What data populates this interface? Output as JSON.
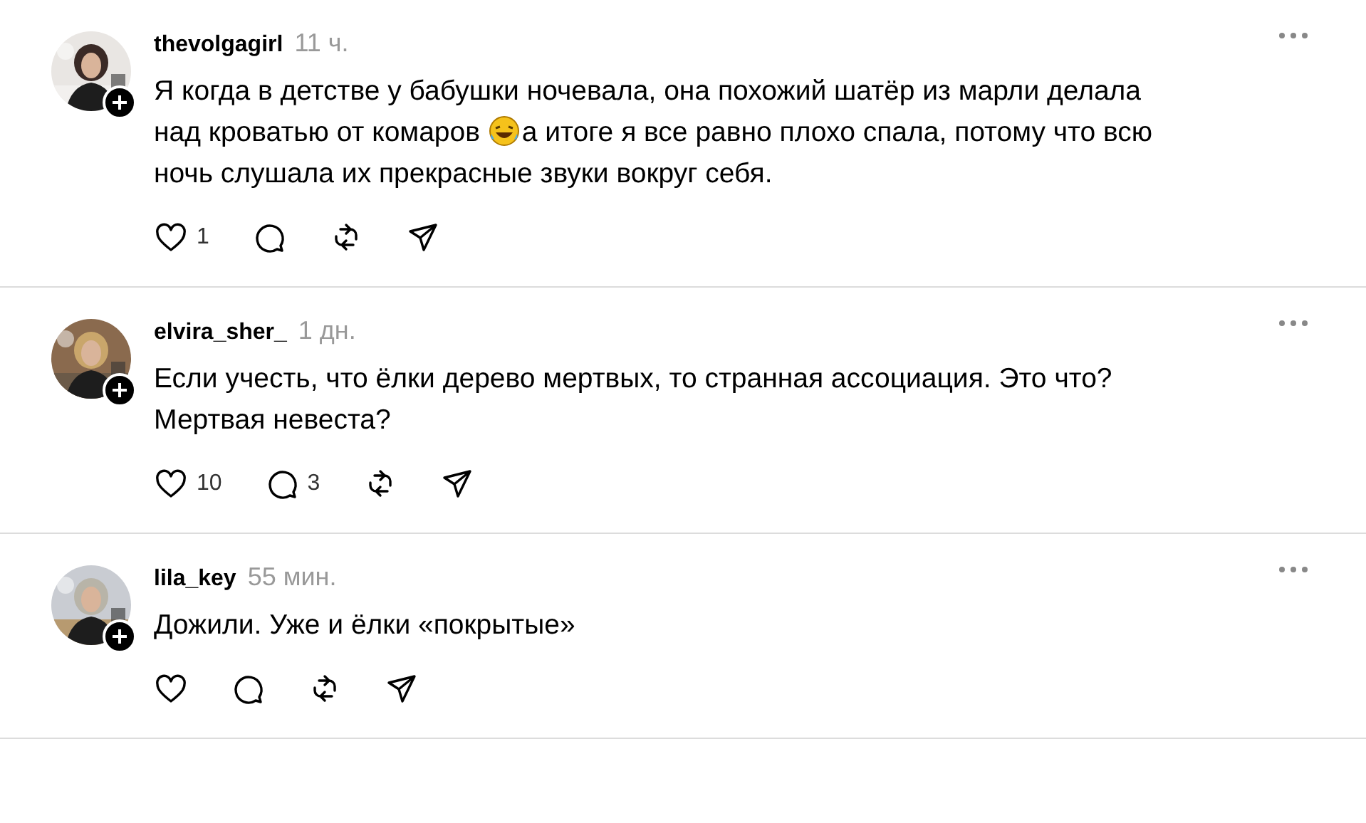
{
  "comments": [
    {
      "username": "thevolgagirl",
      "time": "11 ч.",
      "lines": [
        [
          "Я когда в детстве у бабушки ночевала, она похожий шатёр из марли делала"
        ],
        [
          "над кроватью от комаров ",
          {
            "kind": "emoji"
          },
          "а итоге я все равно плохо спала, потому что всю"
        ],
        [
          "ночь слушала их прекрасные звуки вокруг себя."
        ]
      ],
      "likes": "1"
    },
    {
      "username": "elvira_sher_",
      "time": "1 дн.",
      "lines": [
        [
          "Если учесть, что ёлки дерево мертвых, то странная ассоциация. Это что?"
        ],
        [
          "Мертвая невеста?"
        ]
      ],
      "likes": "10",
      "replies": "3"
    },
    {
      "username": "lila_key",
      "time": "55 мин.",
      "lines": [
        [
          "Дожили. Уже и ёлки «покрытые»"
        ]
      ]
    }
  ]
}
